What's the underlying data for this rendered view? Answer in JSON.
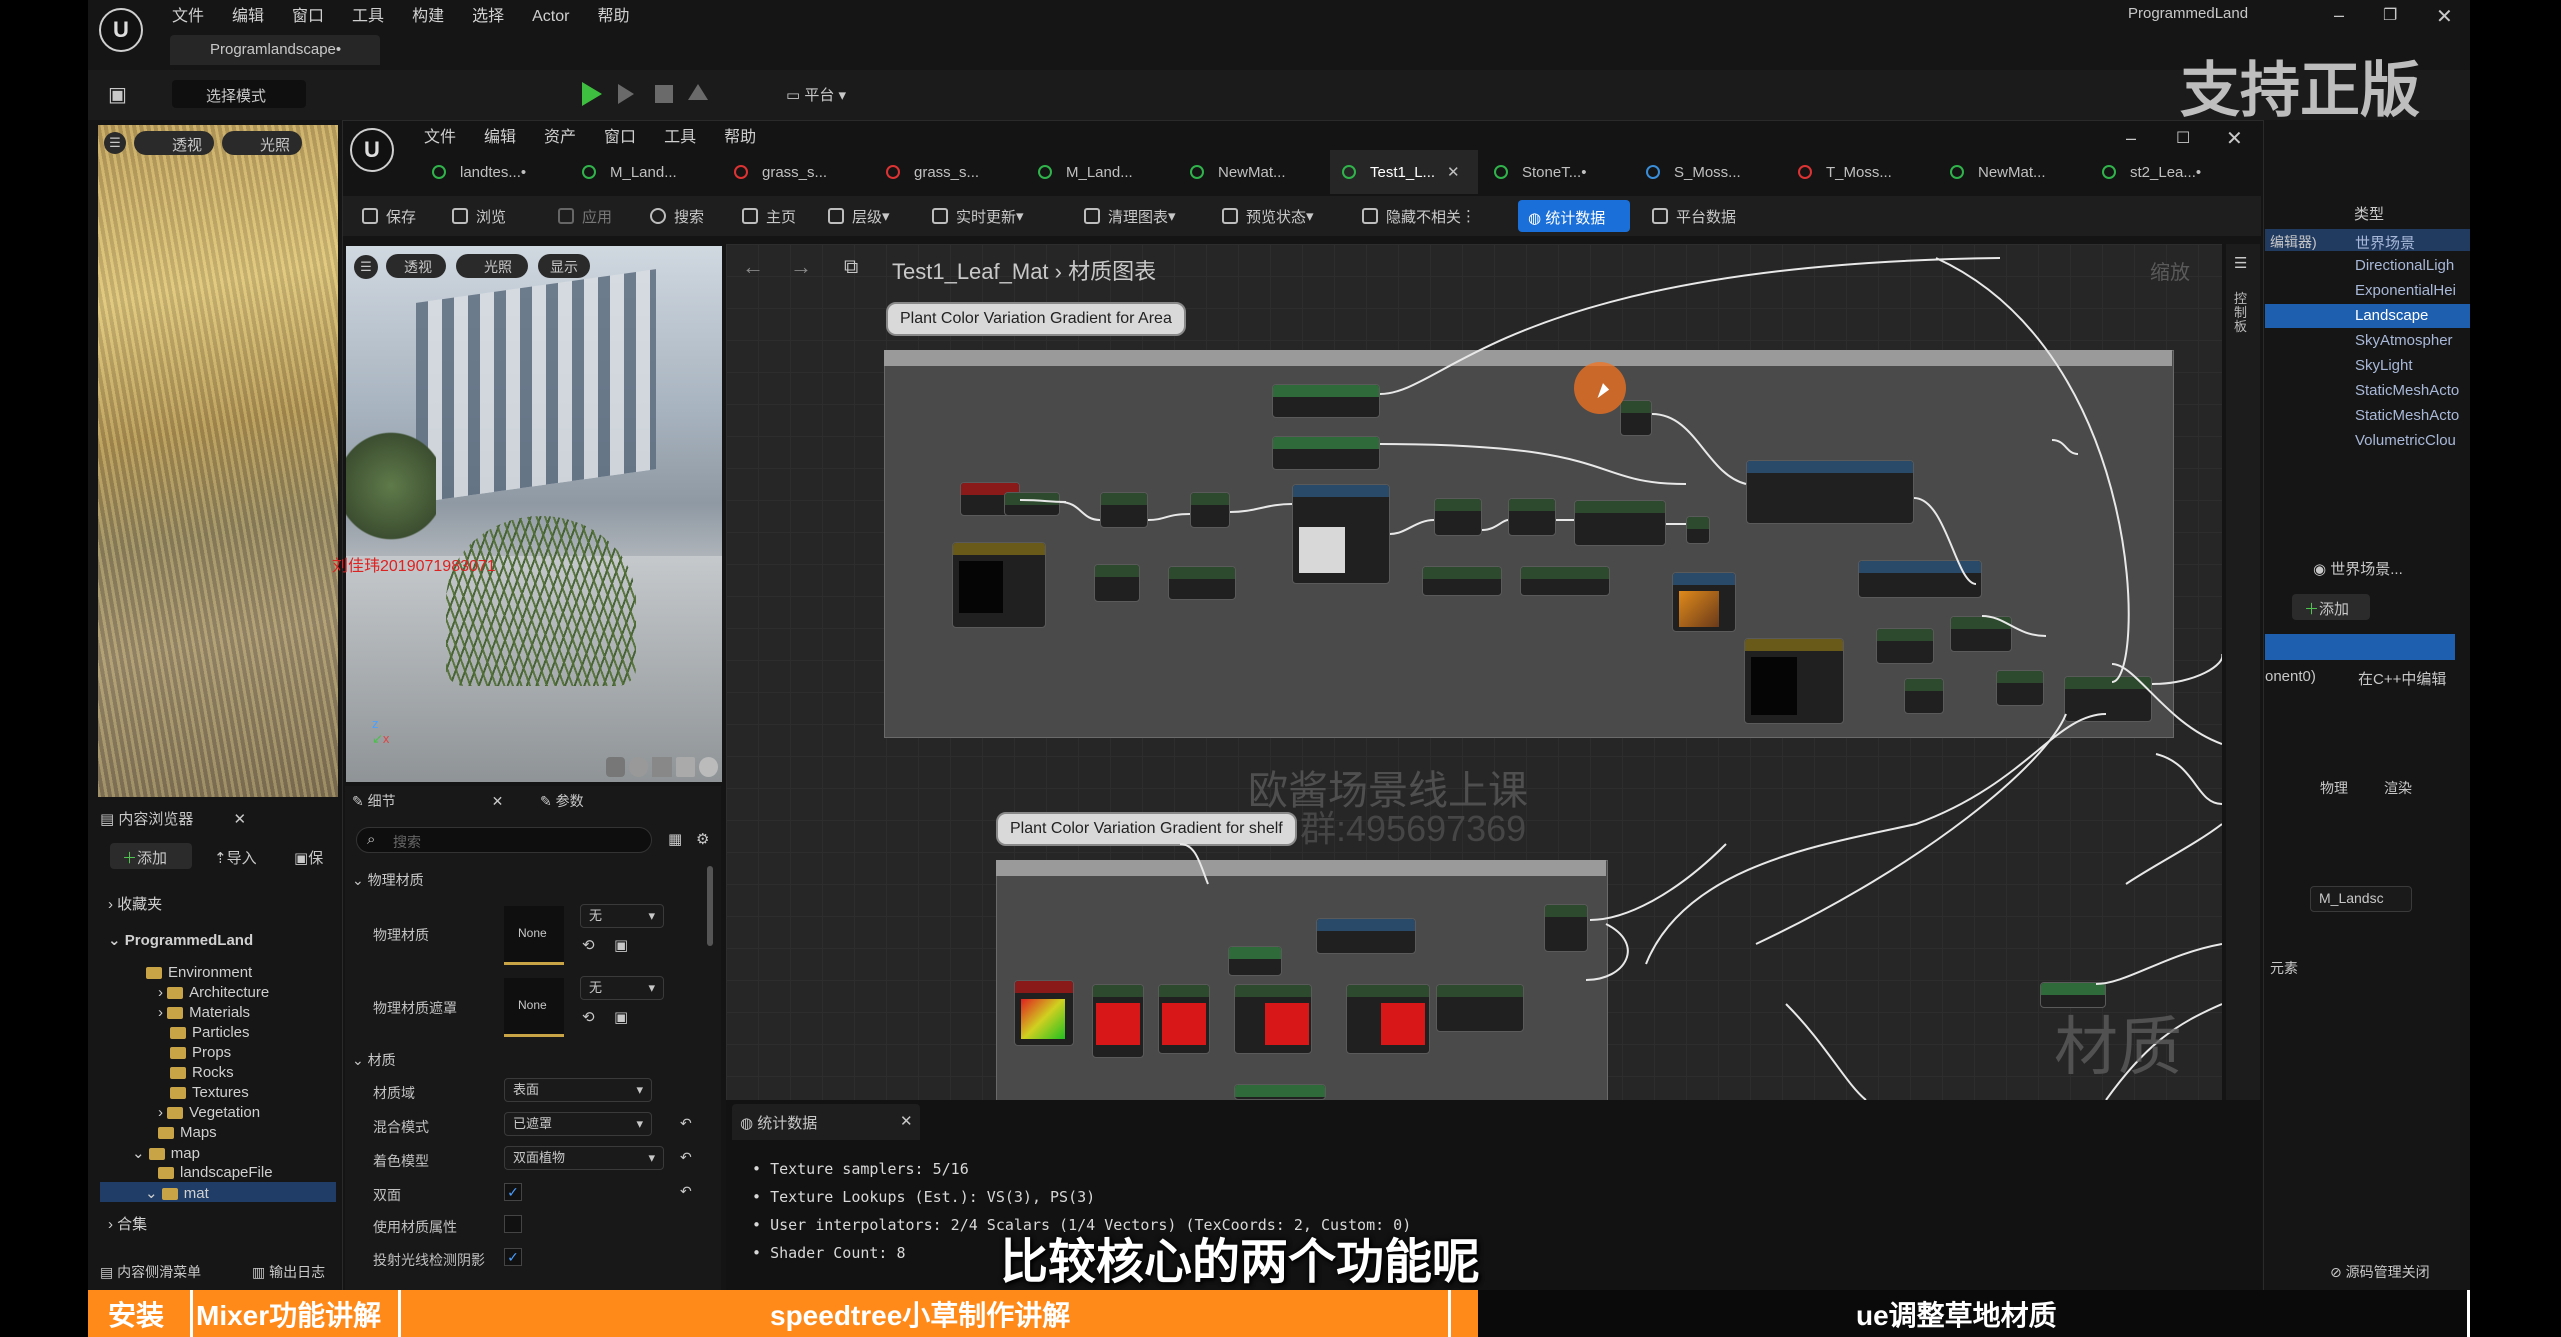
{
  "main_window": {
    "menu": [
      "文件",
      "编辑",
      "窗口",
      "工具",
      "构建",
      "选择",
      "Actor",
      "帮助"
    ],
    "title": "ProgrammedLand",
    "level_tab": "Programlandscape•",
    "mode_button": "选择模式",
    "platform_button": "平台",
    "watermark_support": "支持正版"
  },
  "viewport_left": {
    "buttons": [
      "透视",
      "光照"
    ]
  },
  "content_browser": {
    "tab": "内容浏览器",
    "add": "添加",
    "import": "导入",
    "save": "保",
    "favorites": "收藏夹",
    "root": "ProgrammedLand",
    "tree": [
      "Environment",
      "Architecture",
      "Materials",
      "Particles",
      "Props",
      "Rocks",
      "Textures",
      "Vegetation",
      "Maps",
      "map",
      "landscapeFile",
      "mat"
    ],
    "collections": "合集",
    "drawer": "内容侧滑菜单",
    "output_log": "输出日志"
  },
  "material_editor": {
    "menu": [
      "文件",
      "编辑",
      "资产",
      "窗口",
      "工具",
      "帮助"
    ],
    "tabs": [
      "landtes...•",
      "M_Land...",
      "grass_s...",
      "grass_s...",
      "M_Land...",
      "NewMat...",
      "Test1_L...",
      "StoneT...•",
      "S_Moss...",
      "T_Moss...",
      "NewMat...",
      "st2_Lea...•"
    ],
    "toolbar": [
      "保存",
      "浏览",
      "应用",
      "搜索",
      "主页",
      "层级",
      "实时更新",
      "清理图表",
      "预览状态",
      "隐藏不相关",
      "统计数据",
      "平台数据"
    ],
    "preview_buttons": [
      "透视",
      "光照",
      "显示"
    ],
    "preview_overlay": "刘佳玮2019071983071",
    "breadcrumb": {
      "asset": "Test1_Leaf_Mat",
      "graph": "材质图表"
    },
    "zoom": "缩放",
    "side_tab": "控制板"
  },
  "graph": {
    "comment1_label": "Plant Color Variation Gradient for Area",
    "comment2_label": "Plant Color Variation Gradient for shelf",
    "watermark_course": "欧酱场景线上课",
    "watermark_group": "群:495697369",
    "watermark_material": "材质"
  },
  "details_panel": {
    "tab_details": "细节",
    "tab_params": "参数",
    "search_placeholder": "搜索",
    "section_physical": "物理材质",
    "phys_material": "物理材质",
    "phys_mask": "物理材质遮罩",
    "none": "None",
    "none_cn": "无",
    "section_material": "材质",
    "domain_label": "材质域",
    "domain_value": "表面",
    "blend_label": "混合模式",
    "blend_value": "已遮罩",
    "shading_label": "着色模型",
    "shading_value": "双面植物",
    "two_sided_label": "双面",
    "use_mat_attr_label": "使用材质属性",
    "cast_rt_shadow_label": "投射光线检测阴影"
  },
  "stats_panel": {
    "tab": "统计数据",
    "lines": [
      "Texture samplers: 5/16",
      "Texture Lookups (Est.): VS(3), PS(3)",
      "User interpolators: 2/4 Scalars (1/4 Vectors) (TexCoords: 2, Custom: 0)",
      "Shader Count: 8"
    ]
  },
  "outliner": {
    "header_type": "类型",
    "items": [
      "世界场景",
      "DirectionalLigh",
      "ExponentialHei",
      "Landscape",
      "SkyAtmospher",
      "SkyLight",
      "StaticMeshActo",
      "StaticMeshActo",
      "VolumetricClou"
    ],
    "editor_label": "编辑器)",
    "world_label": "世界场景...",
    "add": "添加",
    "component": "onent0)",
    "edit_cpp": "在C++中编辑",
    "physics": "物理",
    "render": "渲染",
    "material_slot": "M_Landsc",
    "elements": "元素",
    "source_control": "源码管理关闭"
  },
  "subtitle": "比较核心的两个功能呢",
  "chapter_bar": {
    "seg1": "安装",
    "seg2": "Mixer功能讲解",
    "seg3": "speedtree小草制作讲解",
    "seg4": "ue调整草地材质"
  },
  "colors": {
    "accent_blue": "#1a6fd8",
    "chapter_orange": "#ff8a1a",
    "panel_bg": "#161616",
    "graph_bg": "#262626"
  }
}
